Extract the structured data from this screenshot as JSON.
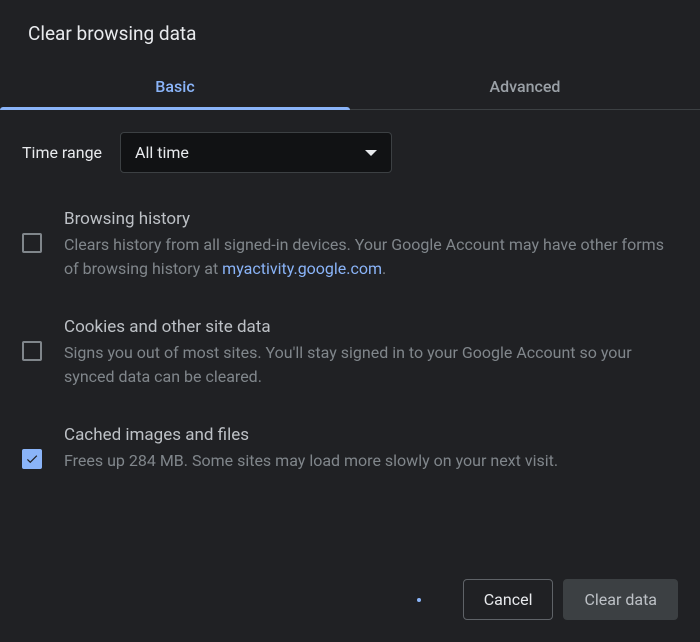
{
  "dialog": {
    "title": "Clear browsing data"
  },
  "tabs": {
    "basic": "Basic",
    "advanced": "Advanced"
  },
  "time": {
    "label": "Time range",
    "selected": "All time"
  },
  "options": {
    "browsing": {
      "title": "Browsing history",
      "desc_before": "Clears history from all signed-in devices. Your Google Account may have other forms of browsing history at ",
      "link": "myactivity.google.com",
      "desc_after": "."
    },
    "cookies": {
      "title": "Cookies and other site data",
      "desc": "Signs you out of most sites. You'll stay signed in to your Google Account so your synced data can be cleared."
    },
    "cache": {
      "title": "Cached images and files",
      "desc": "Frees up 284 MB. Some sites may load more slowly on your next visit."
    }
  },
  "buttons": {
    "cancel": "Cancel",
    "clear": "Clear data"
  }
}
